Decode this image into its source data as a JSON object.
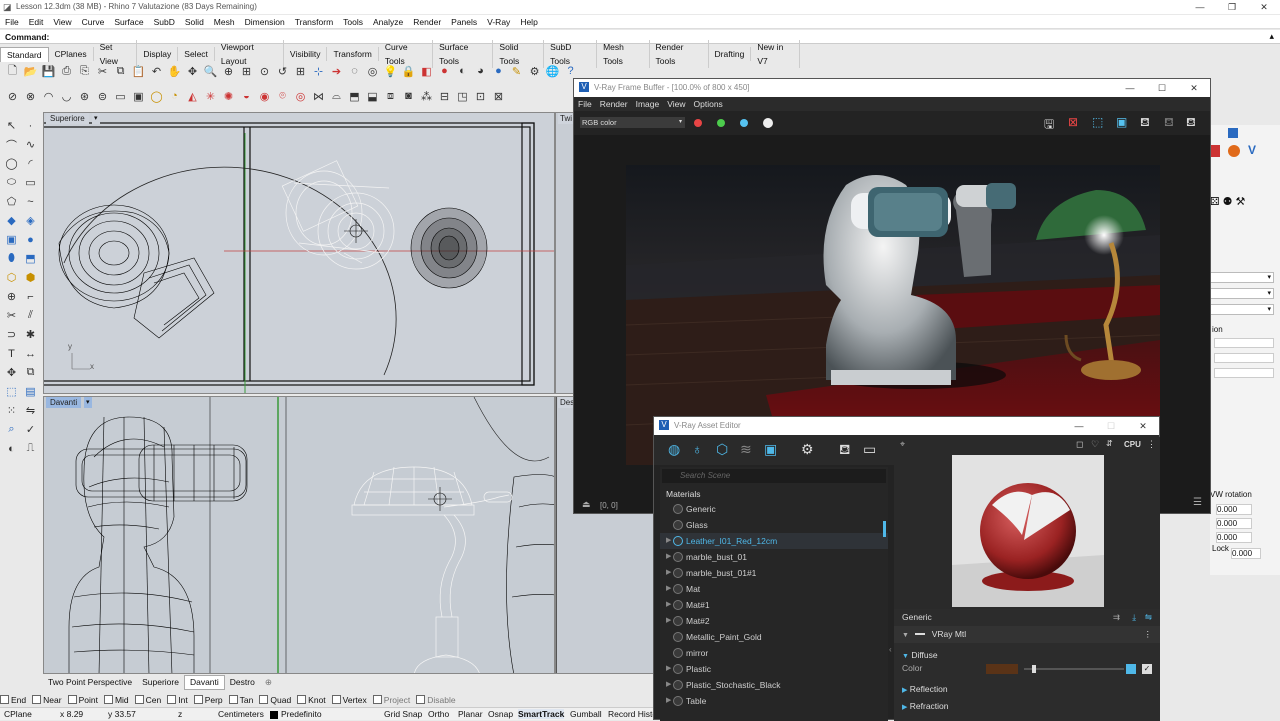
{
  "window": {
    "title": "Lesson 12.3dm (38 MB) - Rhino 7 Valutazione (83 Days Remaining)"
  },
  "menu": [
    "File",
    "Edit",
    "View",
    "Curve",
    "Surface",
    "SubD",
    "Solid",
    "Mesh",
    "Dimension",
    "Transform",
    "Tools",
    "Analyze",
    "Render",
    "Panels",
    "V-Ray",
    "Help"
  ],
  "command": {
    "label": "Command:"
  },
  "tabs": [
    "Standard",
    "CPlanes",
    "Set View",
    "Display",
    "Select",
    "Viewport Layout",
    "Visibility",
    "Transform",
    "Curve Tools",
    "Surface Tools",
    "Solid Tools",
    "SubD Tools",
    "Mesh Tools",
    "Render Tools",
    "Drafting",
    "New in V7"
  ],
  "viewports": {
    "top": {
      "label": "Superiore",
      "axis_y": "y",
      "axis_x": "x"
    },
    "front": {
      "label": "Davanti"
    },
    "side_label": "Twi",
    "side2_label": "Des"
  },
  "viewport_tabs": [
    "Two Point Perspective",
    "Superiore",
    "Davanti",
    "Destro"
  ],
  "osnaps": [
    "End",
    "Near",
    "Point",
    "Mid",
    "Cen",
    "Int",
    "Perp",
    "Tan",
    "Quad",
    "Knot",
    "Vertex",
    "Project",
    "Disable"
  ],
  "status": {
    "cplane": "CPlane",
    "x": "x 8.29",
    "y": "y 33.57",
    "z": "z",
    "units": "Centimeters",
    "layer": "Predefinito",
    "toggles": [
      "Grid Snap",
      "Ortho",
      "Planar",
      "Osnap",
      "SmartTrack",
      "Gumball",
      "Record History"
    ]
  },
  "right_panel": {
    "labels": [
      "ion",
      "VW rotation",
      "Lock"
    ],
    "values": [
      "0.000",
      "0.000",
      "0.000",
      "0.000"
    ]
  },
  "vfb": {
    "title": "V-Ray Frame Buffer - [100.0% of 800 x 450]",
    "menu": [
      "File",
      "Render",
      "Image",
      "View",
      "Options"
    ],
    "channel": "RGB color",
    "coords": "[0, 0]",
    "colors": {
      "red": "#e84545",
      "green": "#4ccb4c",
      "blue": "#56c2f0"
    }
  },
  "asset_editor": {
    "title": "V-Ray Asset Editor",
    "search_placeholder": "Search Scene",
    "section": "Materials",
    "materials": [
      "Generic",
      "Glass",
      "Leather_I01_Red_12cm",
      "marble_bust_01",
      "marble_bust_01#1",
      "Mat",
      "Mat#1",
      "Mat#2",
      "Metallic_Paint_Gold",
      "mirror",
      "Plastic",
      "Plastic_Stochastic_Black",
      "Table"
    ],
    "selected": "Leather_I01_Red_12cm",
    "engine": "CPU",
    "props": {
      "category": "Generic",
      "type": "VRay Mtl",
      "diffuse": "Diffuse",
      "color": "Color",
      "reflection": "Reflection",
      "refraction": "Refraction",
      "diffuse_color": "#5a3317"
    }
  }
}
